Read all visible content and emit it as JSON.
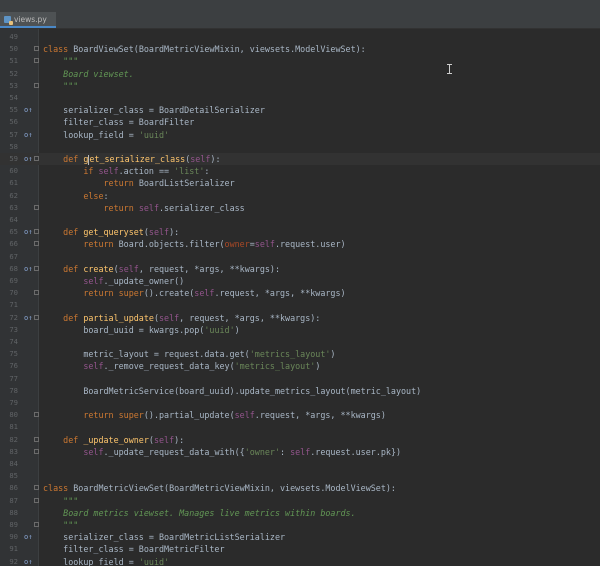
{
  "tab": {
    "label": "views.py",
    "icon": "python-file-icon"
  },
  "lines": [
    {
      "n": "49",
      "mark": "",
      "fold": false,
      "tokens": []
    },
    {
      "n": "50",
      "mark": "",
      "fold": true,
      "tokens": [
        [
          "kw",
          "class "
        ],
        [
          "",
          "BoardViewSet(BoardMetricViewMixin, viewsets.ModelViewSet):"
        ]
      ]
    },
    {
      "n": "51",
      "mark": "",
      "fold": true,
      "tokens": [
        [
          "doc",
          "    \"\"\""
        ]
      ]
    },
    {
      "n": "52",
      "mark": "",
      "fold": false,
      "tokens": [
        [
          "doc",
          "    Board viewset."
        ]
      ]
    },
    {
      "n": "53",
      "mark": "",
      "fold": true,
      "tokens": [
        [
          "doc",
          "    \"\"\""
        ]
      ]
    },
    {
      "n": "54",
      "mark": "",
      "fold": false,
      "tokens": []
    },
    {
      "n": "55",
      "mark": "o↑",
      "fold": false,
      "tokens": [
        [
          "",
          "    serializer_class = BoardDetailSerializer"
        ]
      ]
    },
    {
      "n": "56",
      "mark": "",
      "fold": false,
      "tokens": [
        [
          "",
          "    filter_class = BoardFilter"
        ]
      ]
    },
    {
      "n": "57",
      "mark": "o↑",
      "fold": false,
      "tokens": [
        [
          "",
          "    lookup_field = "
        ],
        [
          "str",
          "'uuid'"
        ]
      ]
    },
    {
      "n": "58",
      "mark": "",
      "fold": false,
      "tokens": []
    },
    {
      "n": "59",
      "mark": "o↑",
      "fold": true,
      "cursor": true,
      "tokens": [
        [
          "kw",
          "    def "
        ],
        [
          "fn",
          "g"
        ],
        [
          "cursor",
          ""
        ],
        [
          "fn",
          "et_serializer_class"
        ],
        [
          "",
          "("
        ],
        [
          "self",
          "self"
        ],
        [
          "",
          "):"
        ]
      ]
    },
    {
      "n": "60",
      "mark": "",
      "fold": false,
      "tokens": [
        [
          "kw",
          "        if "
        ],
        [
          "self",
          "self"
        ],
        [
          "",
          ".action == "
        ],
        [
          "str",
          "'list'"
        ],
        [
          "",
          ":"
        ]
      ]
    },
    {
      "n": "61",
      "mark": "",
      "fold": false,
      "tokens": [
        [
          "kw",
          "            return "
        ],
        [
          "",
          "BoardListSerializer"
        ]
      ]
    },
    {
      "n": "62",
      "mark": "",
      "fold": false,
      "tokens": [
        [
          "kw",
          "        else"
        ],
        [
          "",
          ":"
        ]
      ]
    },
    {
      "n": "63",
      "mark": "",
      "fold": true,
      "tokens": [
        [
          "kw",
          "            return "
        ],
        [
          "self",
          "self"
        ],
        [
          "",
          ".serializer_class"
        ]
      ]
    },
    {
      "n": "64",
      "mark": "",
      "fold": false,
      "tokens": []
    },
    {
      "n": "65",
      "mark": "o↑",
      "fold": true,
      "tokens": [
        [
          "kw",
          "    def "
        ],
        [
          "fn",
          "get_queryset"
        ],
        [
          "",
          "("
        ],
        [
          "self",
          "self"
        ],
        [
          "",
          "):"
        ]
      ]
    },
    {
      "n": "66",
      "mark": "",
      "fold": true,
      "tokens": [
        [
          "kw",
          "        return "
        ],
        [
          "",
          "Board.objects.filter("
        ],
        [
          "param",
          "owner"
        ],
        [
          "",
          "="
        ],
        [
          "self",
          "self"
        ],
        [
          "",
          ".request.user)"
        ]
      ]
    },
    {
      "n": "67",
      "mark": "",
      "fold": false,
      "tokens": []
    },
    {
      "n": "68",
      "mark": "o↑",
      "fold": true,
      "tokens": [
        [
          "kw",
          "    def "
        ],
        [
          "fn",
          "create"
        ],
        [
          "",
          "("
        ],
        [
          "self",
          "self"
        ],
        [
          "",
          ", request, *args, **kwargs):"
        ]
      ]
    },
    {
      "n": "69",
      "mark": "",
      "fold": false,
      "tokens": [
        [
          "self",
          "        self"
        ],
        [
          "",
          "._update_owner()"
        ]
      ]
    },
    {
      "n": "70",
      "mark": "",
      "fold": true,
      "tokens": [
        [
          "kw",
          "        return "
        ],
        [
          "kw",
          "super"
        ],
        [
          "",
          "().create("
        ],
        [
          "self",
          "self"
        ],
        [
          "",
          ".request, *args, **kwargs)"
        ]
      ]
    },
    {
      "n": "71",
      "mark": "",
      "fold": false,
      "tokens": []
    },
    {
      "n": "72",
      "mark": "o↑",
      "fold": true,
      "tokens": [
        [
          "kw",
          "    def "
        ],
        [
          "fn",
          "partial_update"
        ],
        [
          "",
          "("
        ],
        [
          "self",
          "self"
        ],
        [
          "",
          ", request, *args, **kwargs):"
        ]
      ]
    },
    {
      "n": "73",
      "mark": "",
      "fold": false,
      "tokens": [
        [
          "",
          "        board_uuid = kwargs.pop("
        ],
        [
          "str",
          "'uuid'"
        ],
        [
          "",
          ")"
        ]
      ]
    },
    {
      "n": "74",
      "mark": "",
      "fold": false,
      "tokens": []
    },
    {
      "n": "75",
      "mark": "",
      "fold": false,
      "tokens": [
        [
          "",
          "        metric_layout = request.data.get("
        ],
        [
          "str",
          "'metrics_layout'"
        ],
        [
          "",
          ")"
        ]
      ]
    },
    {
      "n": "76",
      "mark": "",
      "fold": false,
      "tokens": [
        [
          "self",
          "        self"
        ],
        [
          "",
          "._remove_request_data_key("
        ],
        [
          "str",
          "'metrics_layout'"
        ],
        [
          "",
          ")"
        ]
      ]
    },
    {
      "n": "77",
      "mark": "",
      "fold": false,
      "tokens": []
    },
    {
      "n": "78",
      "mark": "",
      "fold": false,
      "tokens": [
        [
          "",
          "        BoardMetricService(board_uuid).update_metrics_layout(metric_layout)"
        ]
      ]
    },
    {
      "n": "79",
      "mark": "",
      "fold": false,
      "tokens": []
    },
    {
      "n": "80",
      "mark": "",
      "fold": true,
      "tokens": [
        [
          "kw",
          "        return "
        ],
        [
          "kw",
          "super"
        ],
        [
          "",
          "().partial_update("
        ],
        [
          "self",
          "self"
        ],
        [
          "",
          ".request, *args, **kwargs)"
        ]
      ]
    },
    {
      "n": "81",
      "mark": "",
      "fold": false,
      "tokens": []
    },
    {
      "n": "82",
      "mark": "",
      "fold": true,
      "tokens": [
        [
          "kw",
          "    def "
        ],
        [
          "fn",
          "_update_owner"
        ],
        [
          "",
          "("
        ],
        [
          "self",
          "self"
        ],
        [
          "",
          "):"
        ]
      ]
    },
    {
      "n": "83",
      "mark": "",
      "fold": true,
      "tokens": [
        [
          "self",
          "        self"
        ],
        [
          "",
          "._update_request_data_with({"
        ],
        [
          "str",
          "'owner'"
        ],
        [
          "",
          ": "
        ],
        [
          "self",
          "self"
        ],
        [
          "",
          ".request.user.pk})"
        ]
      ]
    },
    {
      "n": "84",
      "mark": "",
      "fold": false,
      "tokens": []
    },
    {
      "n": "85",
      "mark": "",
      "fold": false,
      "tokens": []
    },
    {
      "n": "86",
      "mark": "",
      "fold": true,
      "tokens": [
        [
          "kw",
          "class "
        ],
        [
          "",
          "BoardMetricViewSet(BoardMetricViewMixin, viewsets.ModelViewSet):"
        ]
      ]
    },
    {
      "n": "87",
      "mark": "",
      "fold": true,
      "tokens": [
        [
          "doc",
          "    \"\"\""
        ]
      ]
    },
    {
      "n": "88",
      "mark": "",
      "fold": false,
      "tokens": [
        [
          "doc",
          "    Board metrics viewset. Manages live metrics within boards."
        ]
      ]
    },
    {
      "n": "89",
      "mark": "",
      "fold": true,
      "tokens": [
        [
          "doc",
          "    \"\"\""
        ]
      ]
    },
    {
      "n": "90",
      "mark": "o↑",
      "fold": false,
      "tokens": [
        [
          "",
          "    serializer_class = BoardMetricListSerializer"
        ]
      ]
    },
    {
      "n": "91",
      "mark": "",
      "fold": false,
      "tokens": [
        [
          "",
          "    filter_class = BoardMetricFilter"
        ]
      ]
    },
    {
      "n": "92",
      "mark": "o↑",
      "fold": false,
      "tokens": [
        [
          "",
          "    lookup_field = "
        ],
        [
          "str",
          "'uuid'"
        ]
      ]
    }
  ]
}
